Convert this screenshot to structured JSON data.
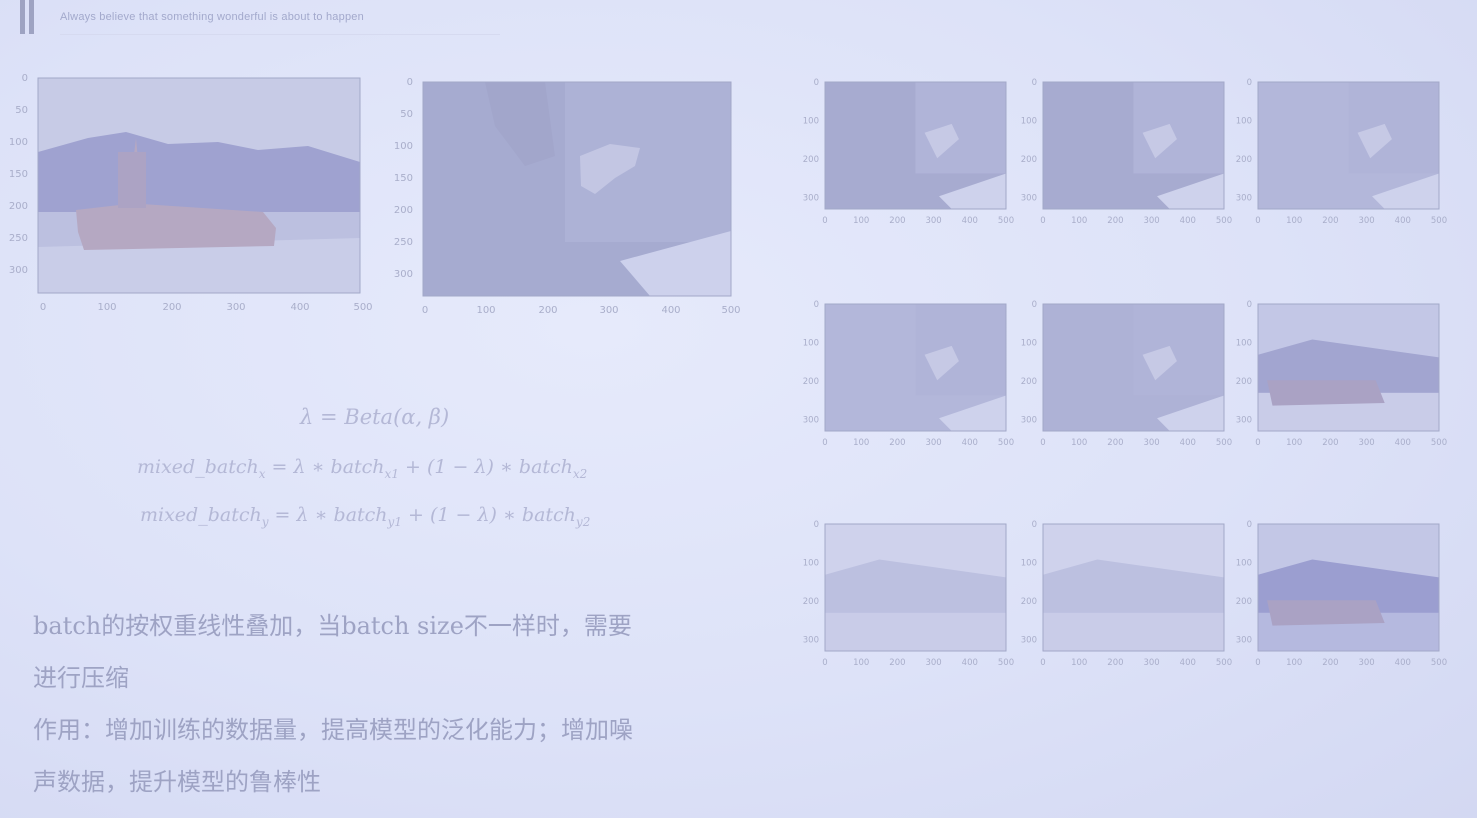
{
  "header": {
    "text": "Always believe that something wonderful is about to happen"
  },
  "formulas": {
    "lambda": "λ = Beta(α, β)",
    "x_lhs": "mixed_batch",
    "x_lhs_sub": "x",
    "x_rhs_a": " = λ ∗ batch",
    "x_rhs_a_sub": "x1",
    "x_rhs_b": " + (1 − λ) ∗ batch",
    "x_rhs_b_sub": "x2",
    "y_lhs": "mixed_batch",
    "y_lhs_sub": "y",
    "y_rhs_a": " = λ ∗ batch",
    "y_rhs_a_sub": "y1",
    "y_rhs_b": " + (1 − λ) ∗ batch",
    "y_rhs_b_sub": "y2"
  },
  "text": {
    "line1": "batch的按权重线性叠加，当batch size不一样时，需要",
    "line2": "进行压缩",
    "line3": "作用：增加训练的数据量，提高模型的泛化能力；增加噪",
    "line4": "声数据，提升模型的鲁棒性"
  },
  "plots": {
    "boat": {
      "xticks": [
        "0",
        "100",
        "200",
        "300",
        "400",
        "500"
      ],
      "yticks": [
        "0",
        "50",
        "100",
        "150",
        "200",
        "250",
        "300"
      ]
    },
    "horse": {
      "xticks": [
        "0",
        "100",
        "200",
        "300",
        "400",
        "500"
      ],
      "yticks": [
        "0",
        "50",
        "100",
        "150",
        "200",
        "250",
        "300"
      ]
    },
    "grid": [
      {
        "xticks": [
          "0",
          "100",
          "200",
          "300",
          "400",
          "500"
        ],
        "yticks": [
          "0",
          "100",
          "200",
          "300"
        ]
      },
      {
        "xticks": [
          "0",
          "100",
          "200",
          "300",
          "400",
          "500"
        ],
        "yticks": [
          "0",
          "100",
          "200",
          "300"
        ]
      },
      {
        "xticks": [
          "0",
          "100",
          "200",
          "300",
          "400",
          "500"
        ],
        "yticks": [
          "0",
          "100",
          "200",
          "300"
        ]
      },
      {
        "xticks": [
          "0",
          "100",
          "200",
          "300",
          "400",
          "500"
        ],
        "yticks": [
          "0",
          "100",
          "200",
          "300"
        ]
      },
      {
        "xticks": [
          "0",
          "100",
          "200",
          "300",
          "400",
          "500"
        ],
        "yticks": [
          "0",
          "100",
          "200",
          "300"
        ]
      },
      {
        "xticks": [
          "0",
          "100",
          "200",
          "300",
          "400",
          "500"
        ],
        "yticks": [
          "0",
          "100",
          "200",
          "300"
        ]
      },
      {
        "xticks": [
          "0",
          "100",
          "200",
          "300",
          "400",
          "500"
        ],
        "yticks": [
          "0",
          "100",
          "200",
          "300"
        ]
      },
      {
        "xticks": [
          "0",
          "100",
          "200",
          "300",
          "400",
          "500"
        ],
        "yticks": [
          "0",
          "100",
          "200",
          "300"
        ]
      },
      {
        "xticks": [
          "0",
          "100",
          "200",
          "300",
          "400",
          "500"
        ],
        "yticks": [
          "0",
          "100",
          "200",
          "300"
        ]
      }
    ]
  }
}
